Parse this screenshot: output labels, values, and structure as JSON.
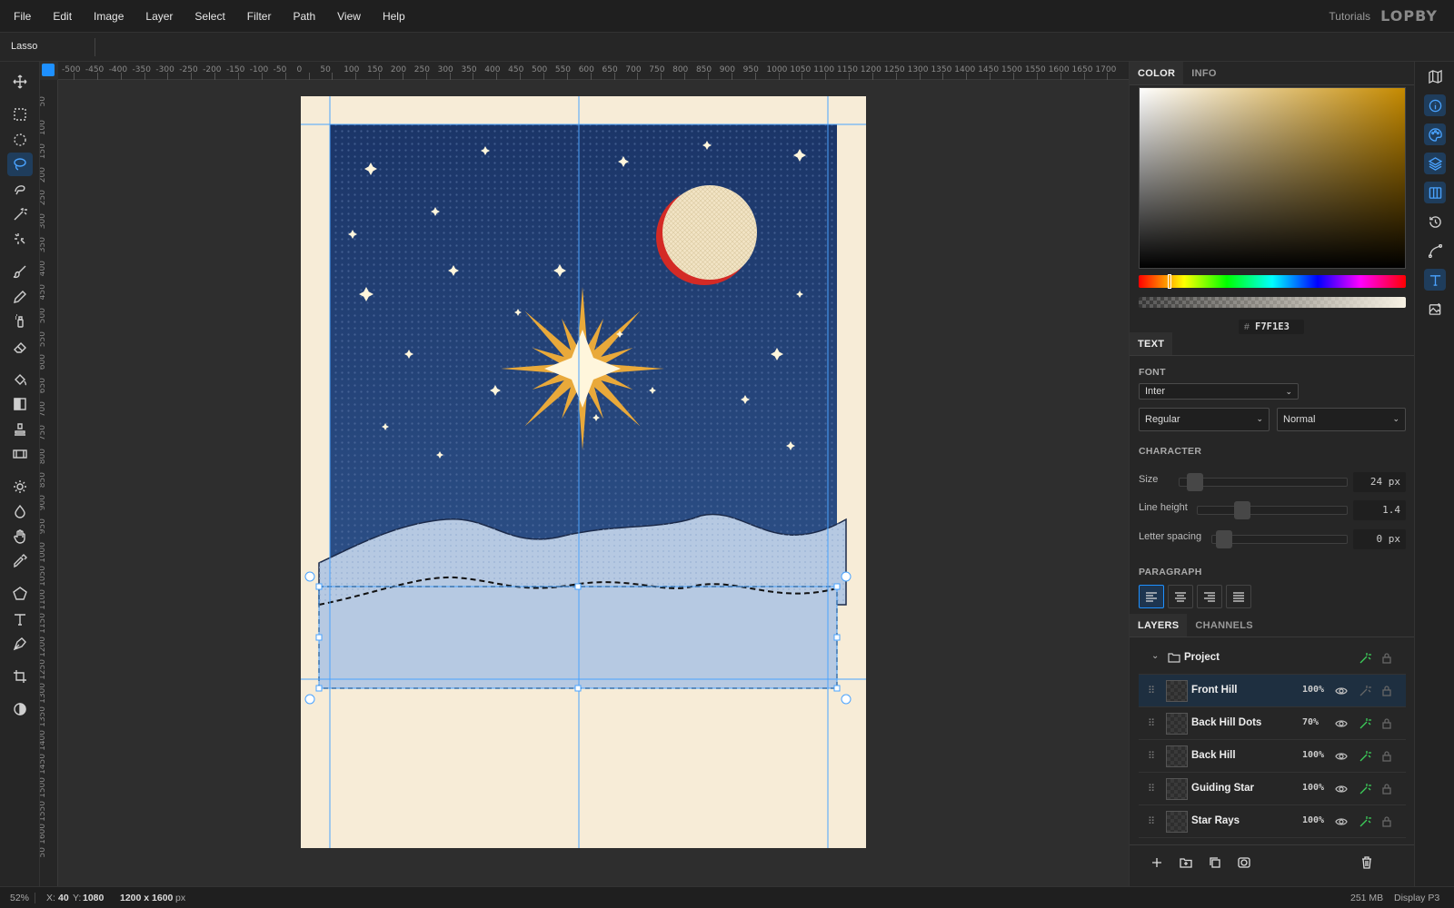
{
  "menu": {
    "items": [
      "File",
      "Edit",
      "Image",
      "Layer",
      "Select",
      "Filter",
      "Path",
      "View",
      "Help"
    ],
    "tutorials": "Tutorials",
    "logo": "LOPBY"
  },
  "options_bar": {
    "tool_name": "Lasso"
  },
  "tools": [
    "move-tool",
    "rect-marquee-tool",
    "ellipse-marquee-tool",
    "lasso-tool",
    "quick-selection-tool",
    "magic-wand-tool",
    "object-select-tool",
    "brush-tool",
    "pencil-tool",
    "spray-tool",
    "eraser-tool",
    "paint-bucket-tool",
    "gradient-tool",
    "clone-stamp-tool",
    "filmstrip-tool",
    "dodge-tool",
    "burn-tool",
    "hand-tool",
    "eyedropper-tool",
    "polygon-tool",
    "type-tool",
    "pen-tool",
    "crop-tool",
    "contrast-tool"
  ],
  "ruler": {
    "h_labels": [
      "-500",
      "-450",
      "-400",
      "-350",
      "-300",
      "-250",
      "-200",
      "-150",
      "-100",
      "-50",
      "0",
      "50",
      "100",
      "150",
      "200",
      "250",
      "300",
      "350",
      "400",
      "450",
      "500",
      "550",
      "600",
      "650",
      "700",
      "750",
      "800",
      "850",
      "900",
      "950",
      "1000",
      "1050",
      "1100",
      "1150",
      "1200",
      "1250",
      "1300",
      "1350",
      "1400",
      "1450",
      "1500",
      "1550",
      "1600",
      "1650",
      "1700"
    ],
    "v_labels": [
      "50",
      "100",
      "150",
      "200",
      "250",
      "300",
      "350",
      "400",
      "450",
      "500",
      "550",
      "600",
      "650",
      "700",
      "750",
      "800",
      "850",
      "900",
      "950",
      "1000",
      "1050",
      "1100",
      "1150",
      "1200",
      "1250",
      "1300",
      "1350",
      "1400",
      "1450",
      "1500",
      "1550",
      "1600",
      "50"
    ]
  },
  "color_panel": {
    "tabs": [
      "COLOR",
      "INFO"
    ],
    "hex_prefix": "#",
    "hex": "F7F1E3",
    "base_hue": "#c58a00"
  },
  "text_panel": {
    "tab": "TEXT",
    "font_label": "FONT",
    "font_family": "Inter",
    "font_weight": "Regular",
    "font_style": "Normal",
    "character_label": "CHARACTER",
    "size_label": "Size",
    "size_value": "24 px",
    "line_height_label": "Line height",
    "line_height_value": "1.4",
    "letter_spacing_label": "Letter spacing",
    "letter_spacing_value": "0 px",
    "paragraph_label": "PARAGRAPH"
  },
  "layers_panel": {
    "tabs": [
      "LAYERS",
      "CHANNELS"
    ],
    "group_name": "Project",
    "layers": [
      {
        "name": "Front Hill",
        "opacity": "100%"
      },
      {
        "name": "Back Hill Dots",
        "opacity": "70%"
      },
      {
        "name": "Back Hill",
        "opacity": "100%"
      },
      {
        "name": "Guiding Star",
        "opacity": "100%"
      },
      {
        "name": "Star Rays",
        "opacity": "100%"
      }
    ]
  },
  "status": {
    "zoom": "52%",
    "x_label": "X:",
    "x": "40",
    "y_label": "Y:",
    "y": "1080",
    "doc_size": "1200 x 1600",
    "doc_unit": "px",
    "memory": "251 MB",
    "profile": "Display P3"
  },
  "colors": {
    "accent": "#1e90ff",
    "sky_top": "#1b3568",
    "sky_bottom": "#2c4f86",
    "paper": "#f7ecd7",
    "hill": "#b6c9e2",
    "star_gold": "#e9a93a",
    "moon_red": "#d42a25"
  }
}
